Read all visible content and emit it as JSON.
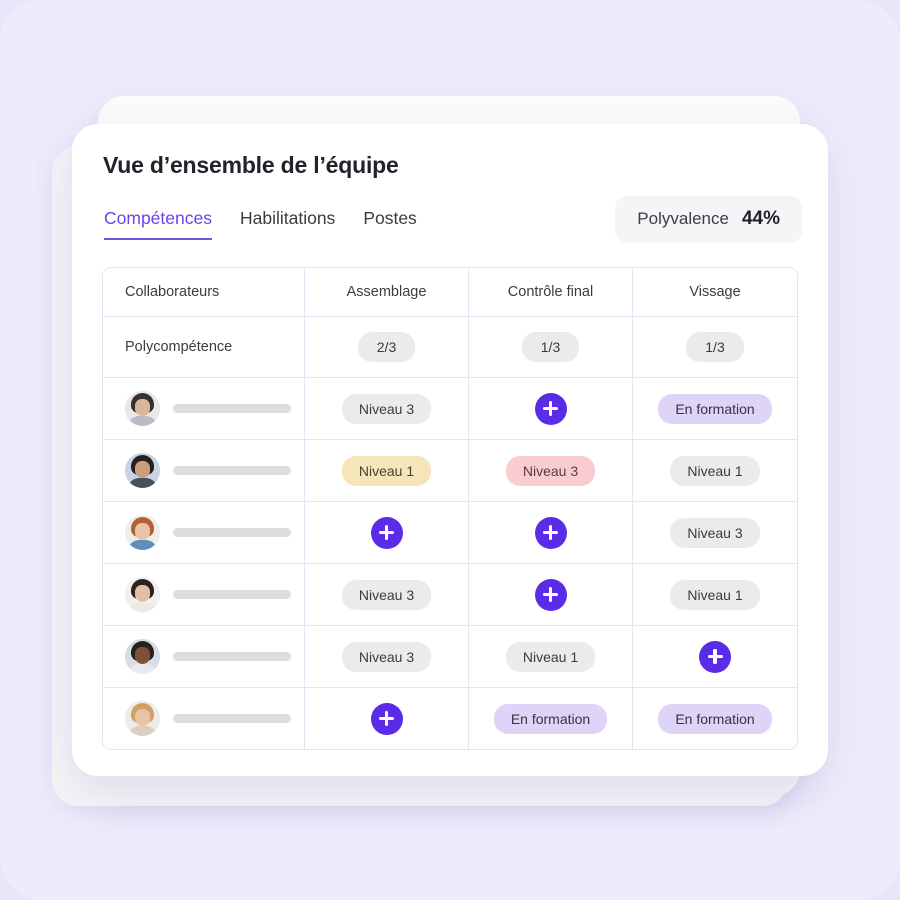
{
  "card": {
    "title": "Vue d’ensemble de l’équipe",
    "tabs": [
      {
        "label": "Compétences",
        "active": true
      },
      {
        "label": "Habilitations",
        "active": false
      },
      {
        "label": "Postes",
        "active": false
      }
    ],
    "polyvalence": {
      "label": "Polyvalence",
      "value": "44%"
    }
  },
  "table": {
    "headers": [
      "Collaborateurs",
      "Assemblage",
      "Contrôle final",
      "Vissage"
    ],
    "summary_row": {
      "label": "Polycompétence",
      "values": [
        "2/3",
        "1/3",
        "1/3"
      ]
    },
    "rows": [
      {
        "avatar": "avatar-person-1",
        "cells": [
          {
            "type": "chip",
            "variant": "grey",
            "label": "Niveau 3"
          },
          {
            "type": "add",
            "label": "+"
          },
          {
            "type": "chip",
            "variant": "purple",
            "label": "En formation"
          }
        ]
      },
      {
        "avatar": "avatar-person-2",
        "cells": [
          {
            "type": "chip",
            "variant": "yellow",
            "label": "Niveau 1"
          },
          {
            "type": "chip",
            "variant": "pink",
            "label": "Niveau 3"
          },
          {
            "type": "chip",
            "variant": "grey",
            "label": "Niveau 1"
          }
        ]
      },
      {
        "avatar": "avatar-person-3",
        "cells": [
          {
            "type": "add",
            "label": "+"
          },
          {
            "type": "add",
            "label": "+"
          },
          {
            "type": "chip",
            "variant": "grey",
            "label": "Niveau 3"
          }
        ]
      },
      {
        "avatar": "avatar-person-4",
        "cells": [
          {
            "type": "chip",
            "variant": "grey",
            "label": "Niveau 3"
          },
          {
            "type": "add",
            "label": "+"
          },
          {
            "type": "chip",
            "variant": "grey",
            "label": "Niveau 1"
          }
        ]
      },
      {
        "avatar": "avatar-person-5",
        "cells": [
          {
            "type": "chip",
            "variant": "grey",
            "label": "Niveau 3"
          },
          {
            "type": "chip",
            "variant": "grey",
            "label": "Niveau 1"
          },
          {
            "type": "add",
            "label": "+"
          }
        ]
      },
      {
        "avatar": "avatar-person-6",
        "cells": [
          {
            "type": "add",
            "label": "+"
          },
          {
            "type": "chip",
            "variant": "purple",
            "label": "En formation"
          },
          {
            "type": "chip",
            "variant": "purple",
            "label": "En formation"
          }
        ]
      }
    ]
  },
  "colors": {
    "background": "#eeecfb",
    "accent": "#6b45e2",
    "add_button": "#5b2ce8",
    "chip_grey": "#ebebec",
    "chip_yellow": "#f6e5b8",
    "chip_pink": "#f9ccd1",
    "chip_purple": "#ded4f8",
    "border": "#e7e3f5"
  },
  "avatar_palettes": {
    "avatar-person-1": {
      "bg": "#e8e8ea",
      "hair": "#3b3029",
      "face": "#d9b79c",
      "body": "#b9bcc4"
    },
    "avatar-person-2": {
      "bg": "#c6d4e4",
      "hair": "#27201c",
      "face": "#c99f80",
      "body": "#4a4f5c"
    },
    "avatar-person-3": {
      "bg": "#f0eeec",
      "hair": "#b4622f",
      "face": "#e8c3a8",
      "body": "#5e8fbc"
    },
    "avatar-person-4": {
      "bg": "#f3f1ef",
      "hair": "#2a2320",
      "face": "#e4bfa6",
      "body": "#ece9e6"
    },
    "avatar-person-5": {
      "bg": "#d6dde6",
      "hair": "#2b211b",
      "face": "#7d5138",
      "body": "#e9eaec"
    },
    "avatar-person-6": {
      "bg": "#efece8",
      "hair": "#cfa062",
      "face": "#e8c4a6",
      "body": "#d9cfc4"
    }
  }
}
